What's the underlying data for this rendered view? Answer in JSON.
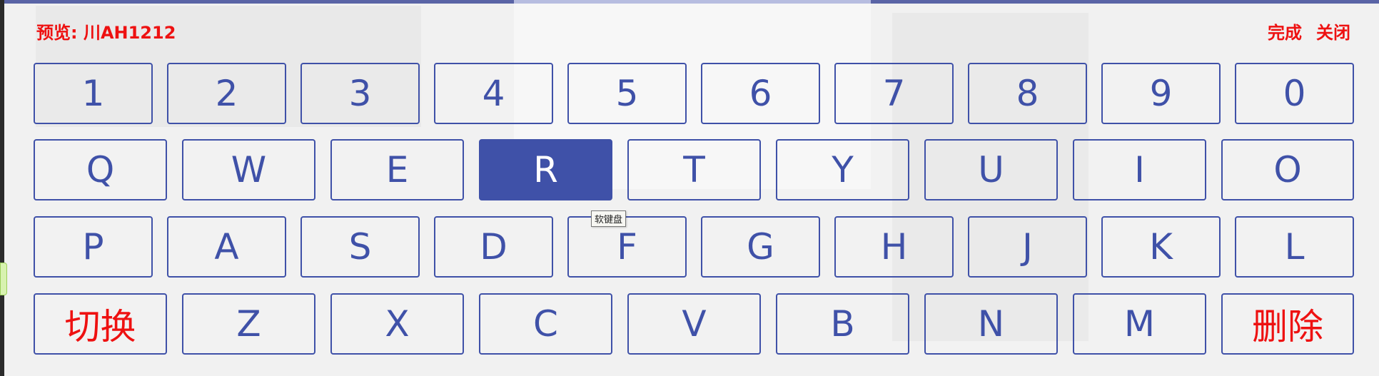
{
  "preview": {
    "label": "预览: 川AH1212"
  },
  "actions": {
    "done": "完成",
    "close": "关闭"
  },
  "tooltip": "软键盘",
  "rows": [
    [
      "1",
      "2",
      "3",
      "4",
      "5",
      "6",
      "7",
      "8",
      "9",
      "0"
    ],
    [
      "Q",
      "W",
      "E",
      "R",
      "T",
      "Y",
      "U",
      "I",
      "O"
    ],
    [
      "P",
      "A",
      "S",
      "D",
      "F",
      "G",
      "H",
      "J",
      "K",
      "L"
    ],
    [
      "切换",
      "Z",
      "X",
      "C",
      "V",
      "B",
      "N",
      "M",
      "删除"
    ]
  ],
  "active_key": "R",
  "colors": {
    "accent": "#3f51a8",
    "action_red": "#ee1111"
  }
}
